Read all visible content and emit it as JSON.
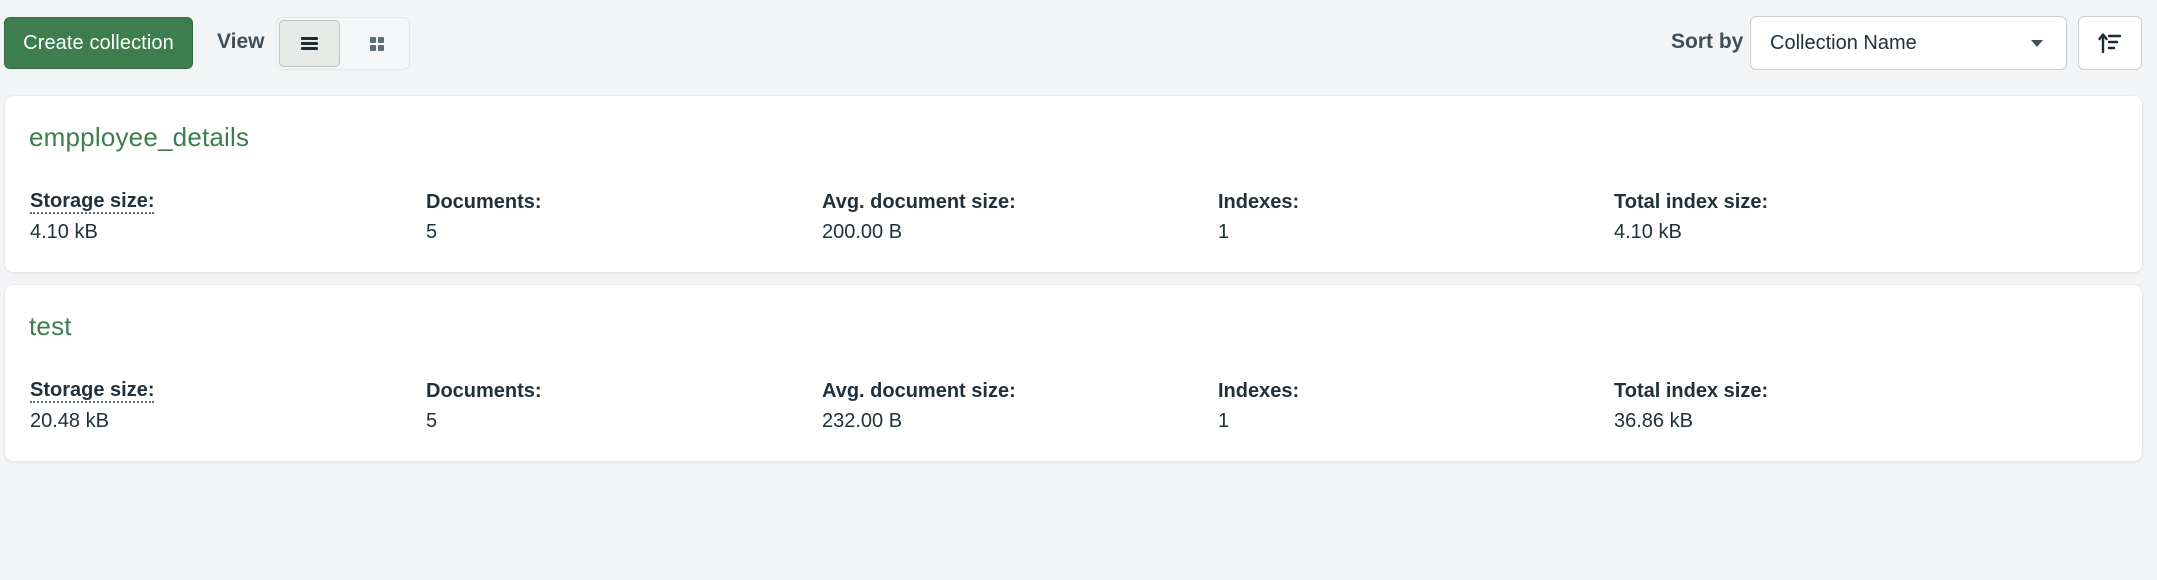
{
  "toolbar": {
    "create_label": "Create collection",
    "view_label": "View",
    "sort_label": "Sort by",
    "sort_value": "Collection Name",
    "view_modes": [
      {
        "icon": "list-icon",
        "active": true
      },
      {
        "icon": "grid-icon",
        "active": false
      }
    ],
    "sort_direction_icon": "sort-ascending-icon"
  },
  "stat_labels": {
    "storage_size": "Storage size:",
    "documents": "Documents:",
    "avg_document_size": "Avg. document size:",
    "indexes": "Indexes:",
    "total_index_size": "Total index size:"
  },
  "collections": [
    {
      "name": "empployee_details",
      "storage_size": "4.10 kB",
      "documents": "5",
      "avg_document_size": "200.00 B",
      "indexes": "1",
      "total_index_size": "4.10 kB"
    },
    {
      "name": "test",
      "storage_size": "20.48 kB",
      "documents": "5",
      "avg_document_size": "232.00 B",
      "indexes": "1",
      "total_index_size": "36.86 kB"
    }
  ],
  "colors": {
    "accent": "#3d7d4e",
    "background": "#f3f4f6",
    "text": "#21313c"
  }
}
